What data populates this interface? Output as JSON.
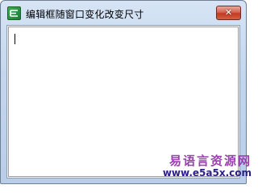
{
  "window": {
    "title": "编辑框随窗口变化改变尺寸",
    "icon": "easy-language-app-icon",
    "close_glyph": "✕"
  },
  "editbox": {
    "value": ""
  },
  "watermark": {
    "name": "易语言资源网",
    "url": "www.e5a5x.com"
  },
  "colors": {
    "close_button": "#c23a24",
    "watermark_name": "#9b3fb0",
    "watermark_url": "#2a1f8a"
  }
}
